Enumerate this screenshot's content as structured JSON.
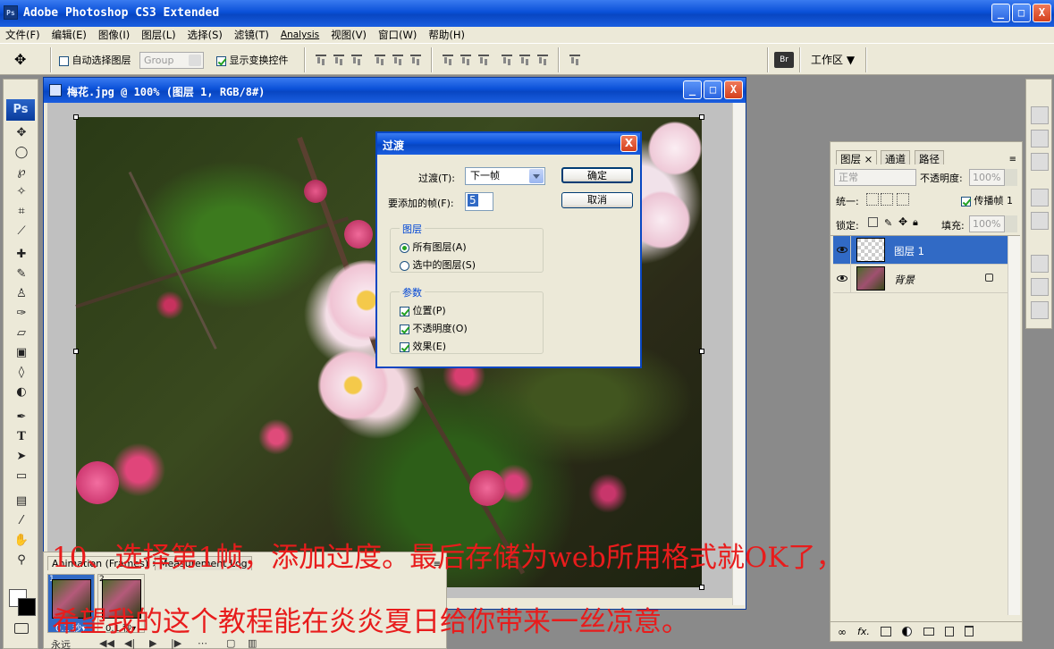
{
  "app": {
    "title": "Adobe Photoshop CS3 Extended",
    "icon": "Ps",
    "minimize": "_",
    "maximize": "□",
    "close": "X"
  },
  "menu": [
    "文件(F)",
    "编辑(E)",
    "图像(I)",
    "图层(L)",
    "选择(S)",
    "滤镜(T)",
    "Analysis",
    "视图(V)",
    "窗口(W)",
    "帮助(H)"
  ],
  "options": {
    "move_tool_icon": "move-tool-icon",
    "auto_select_label": "自动选择图层",
    "auto_select_checked": false,
    "group_value": "Group",
    "show_transform_label": "显示变换控件",
    "show_transform_checked": true,
    "workspace_label": "工作区 ▼",
    "bridge_icon": "Br"
  },
  "toolbox": {
    "logo": "Ps",
    "tools": [
      "move",
      "marquee",
      "lasso",
      "magic-wand",
      "crop",
      "slice",
      "healing",
      "brush",
      "stamp",
      "history-brush",
      "eraser",
      "gradient",
      "blur",
      "dodge",
      "pen",
      "type",
      "path-select",
      "shape",
      "notes",
      "eyedropper",
      "hand",
      "zoom"
    ],
    "type_glyph": "T"
  },
  "document": {
    "title": "梅花.jpg @ 100% (图层 1, RGB/8#)"
  },
  "fade_dialog": {
    "title": "过渡",
    "tween_with_label": "过渡(T):",
    "tween_with_value": "下一帧",
    "frames_label": "要添加的帧(F):",
    "frames_value": "5",
    "ok": "确定",
    "cancel": "取消",
    "layers_group": "图层",
    "all_layers": "所有图层(A)",
    "selected_layers": "选中的图层(S)",
    "params_group": "参数",
    "position": "位置(P)",
    "opacity": "不透明度(O)",
    "effects": "效果(E)"
  },
  "layers_panel": {
    "tabs": [
      "图层",
      "通道",
      "路径"
    ],
    "blend_mode": "正常",
    "opacity_label": "不透明度:",
    "opacity_value": "100%",
    "unify_label": "统一:",
    "propagate_label": "传播帧 1",
    "lock_label": "锁定:",
    "fill_label": "填充:",
    "fill_value": "100%",
    "layers": [
      {
        "name": "图层 1",
        "selected": true
      },
      {
        "name": "背景",
        "selected": false,
        "locked": true
      }
    ],
    "footer_icons": [
      "link-icon",
      "fx-icon",
      "mask-icon",
      "adjustment-icon",
      "group-icon",
      "new-layer-icon",
      "trash-icon"
    ]
  },
  "animation_panel": {
    "tabs": [
      "Animation (Frames)",
      "Measurement Log"
    ],
    "frames": [
      {
        "number": "1",
        "delay": "0.1 秒▾",
        "selected": true
      },
      {
        "number": "2",
        "delay": "0.1 秒▾",
        "selected": false
      }
    ],
    "loop": "永远"
  },
  "caption": {
    "line1": "10、选择第1帧，添加过度。最后存储为web所用格式就OK了，",
    "line2": "希望我的这个教程能在炎炎夏日给你带来一丝凉意。"
  },
  "colors": {
    "title_bar": "#0a50d8",
    "selection": "#316ac5",
    "caption": "#e81c1c",
    "panel_bg": "#ece9d8"
  }
}
